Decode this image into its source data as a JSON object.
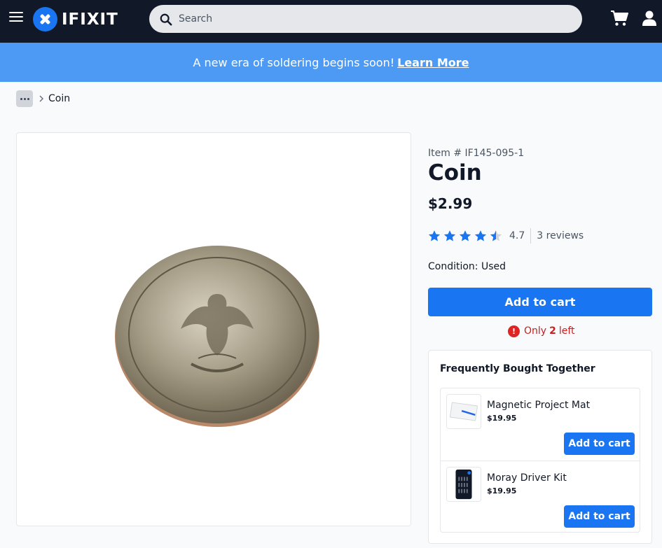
{
  "header": {
    "logo_text": "IFIXIT",
    "search_placeholder": "Search",
    "icons": [
      "menu-icon",
      "ifixit-logo",
      "search-icon",
      "cart-icon",
      "user-icon"
    ]
  },
  "banner": {
    "text": "A new era of soldering begins soon!",
    "link_label": "Learn More"
  },
  "breadcrumb": {
    "current": "Coin"
  },
  "product": {
    "item_number": "Item # IF145-095-1",
    "title": "Coin",
    "price": "$2.99",
    "rating": "4.7",
    "rating_value": 4.7,
    "reviews": "3 reviews",
    "condition": "Condition: Used",
    "add_to_cart": "Add to cart",
    "stock_prefix": "Only",
    "stock_count": "2",
    "stock_suffix": "left"
  },
  "frequently_bought": {
    "title": "Frequently Bought Together",
    "items": [
      {
        "name": "Magnetic Project Mat",
        "price": "$19.95",
        "button": "Add to cart"
      },
      {
        "name": "Moray Driver Kit",
        "price": "$19.95",
        "button": "Add to cart"
      }
    ]
  },
  "colors": {
    "header_bg": "#111827",
    "banner_bg": "#4d9af5",
    "accent": "#1975f1",
    "stock_alert": "#e02424"
  }
}
